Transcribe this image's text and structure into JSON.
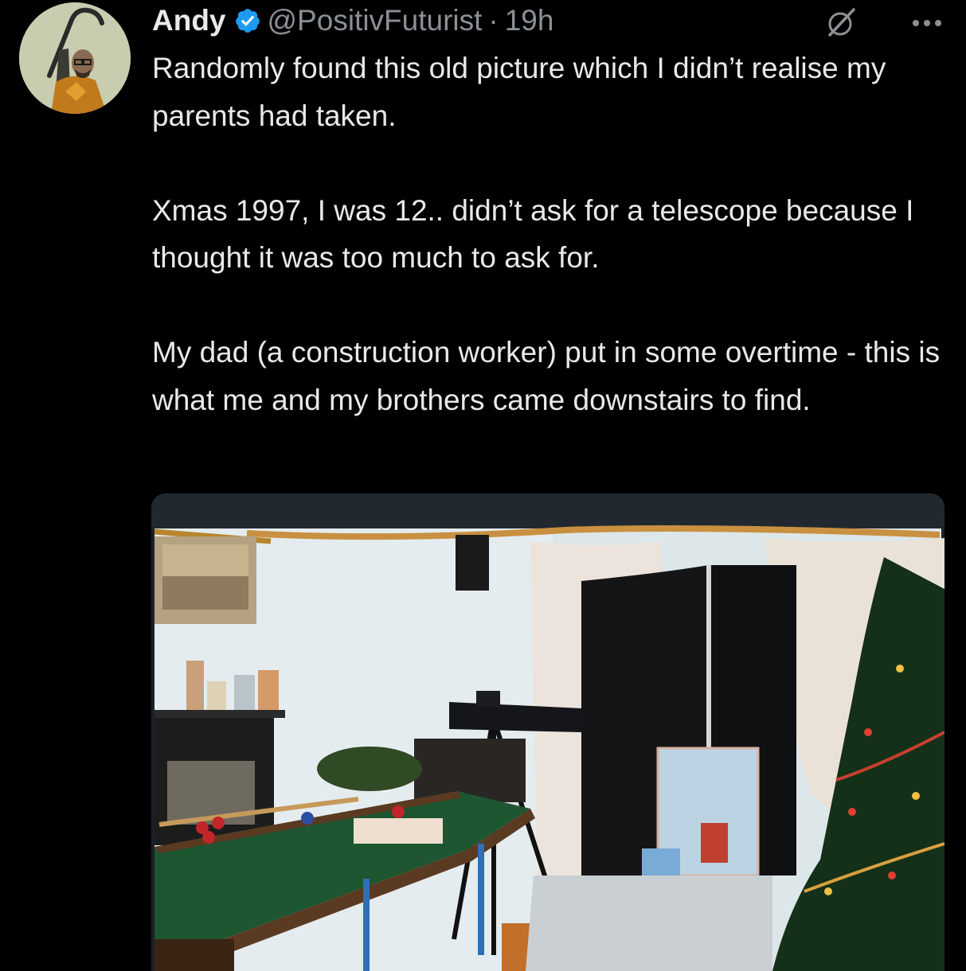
{
  "author": {
    "name": "Andy",
    "handle": "@PositivFuturist",
    "separator": "·",
    "time": "19h",
    "verified": true,
    "verified_badge_color": "#1d9bf0"
  },
  "tweet": {
    "paragraphs": [
      "Randomly found this old picture which I didn’t realise my parents had taken.",
      "Xmas 1997, I was 12.. didn’t ask for a telescope because I thought it was too much to ask for.",
      "My dad (a construction worker) put in some overtime - this is what me and my brothers came downstairs to find."
    ]
  },
  "icons": {
    "avatar": "avatar",
    "verified": "verified-badge-icon",
    "grok": "grok-icon",
    "more": "more-options-icon"
  },
  "colors": {
    "background": "#000000",
    "text": "#e7e9ea",
    "secondary_text": "#8b9095",
    "accent": "#1d9bf0"
  }
}
